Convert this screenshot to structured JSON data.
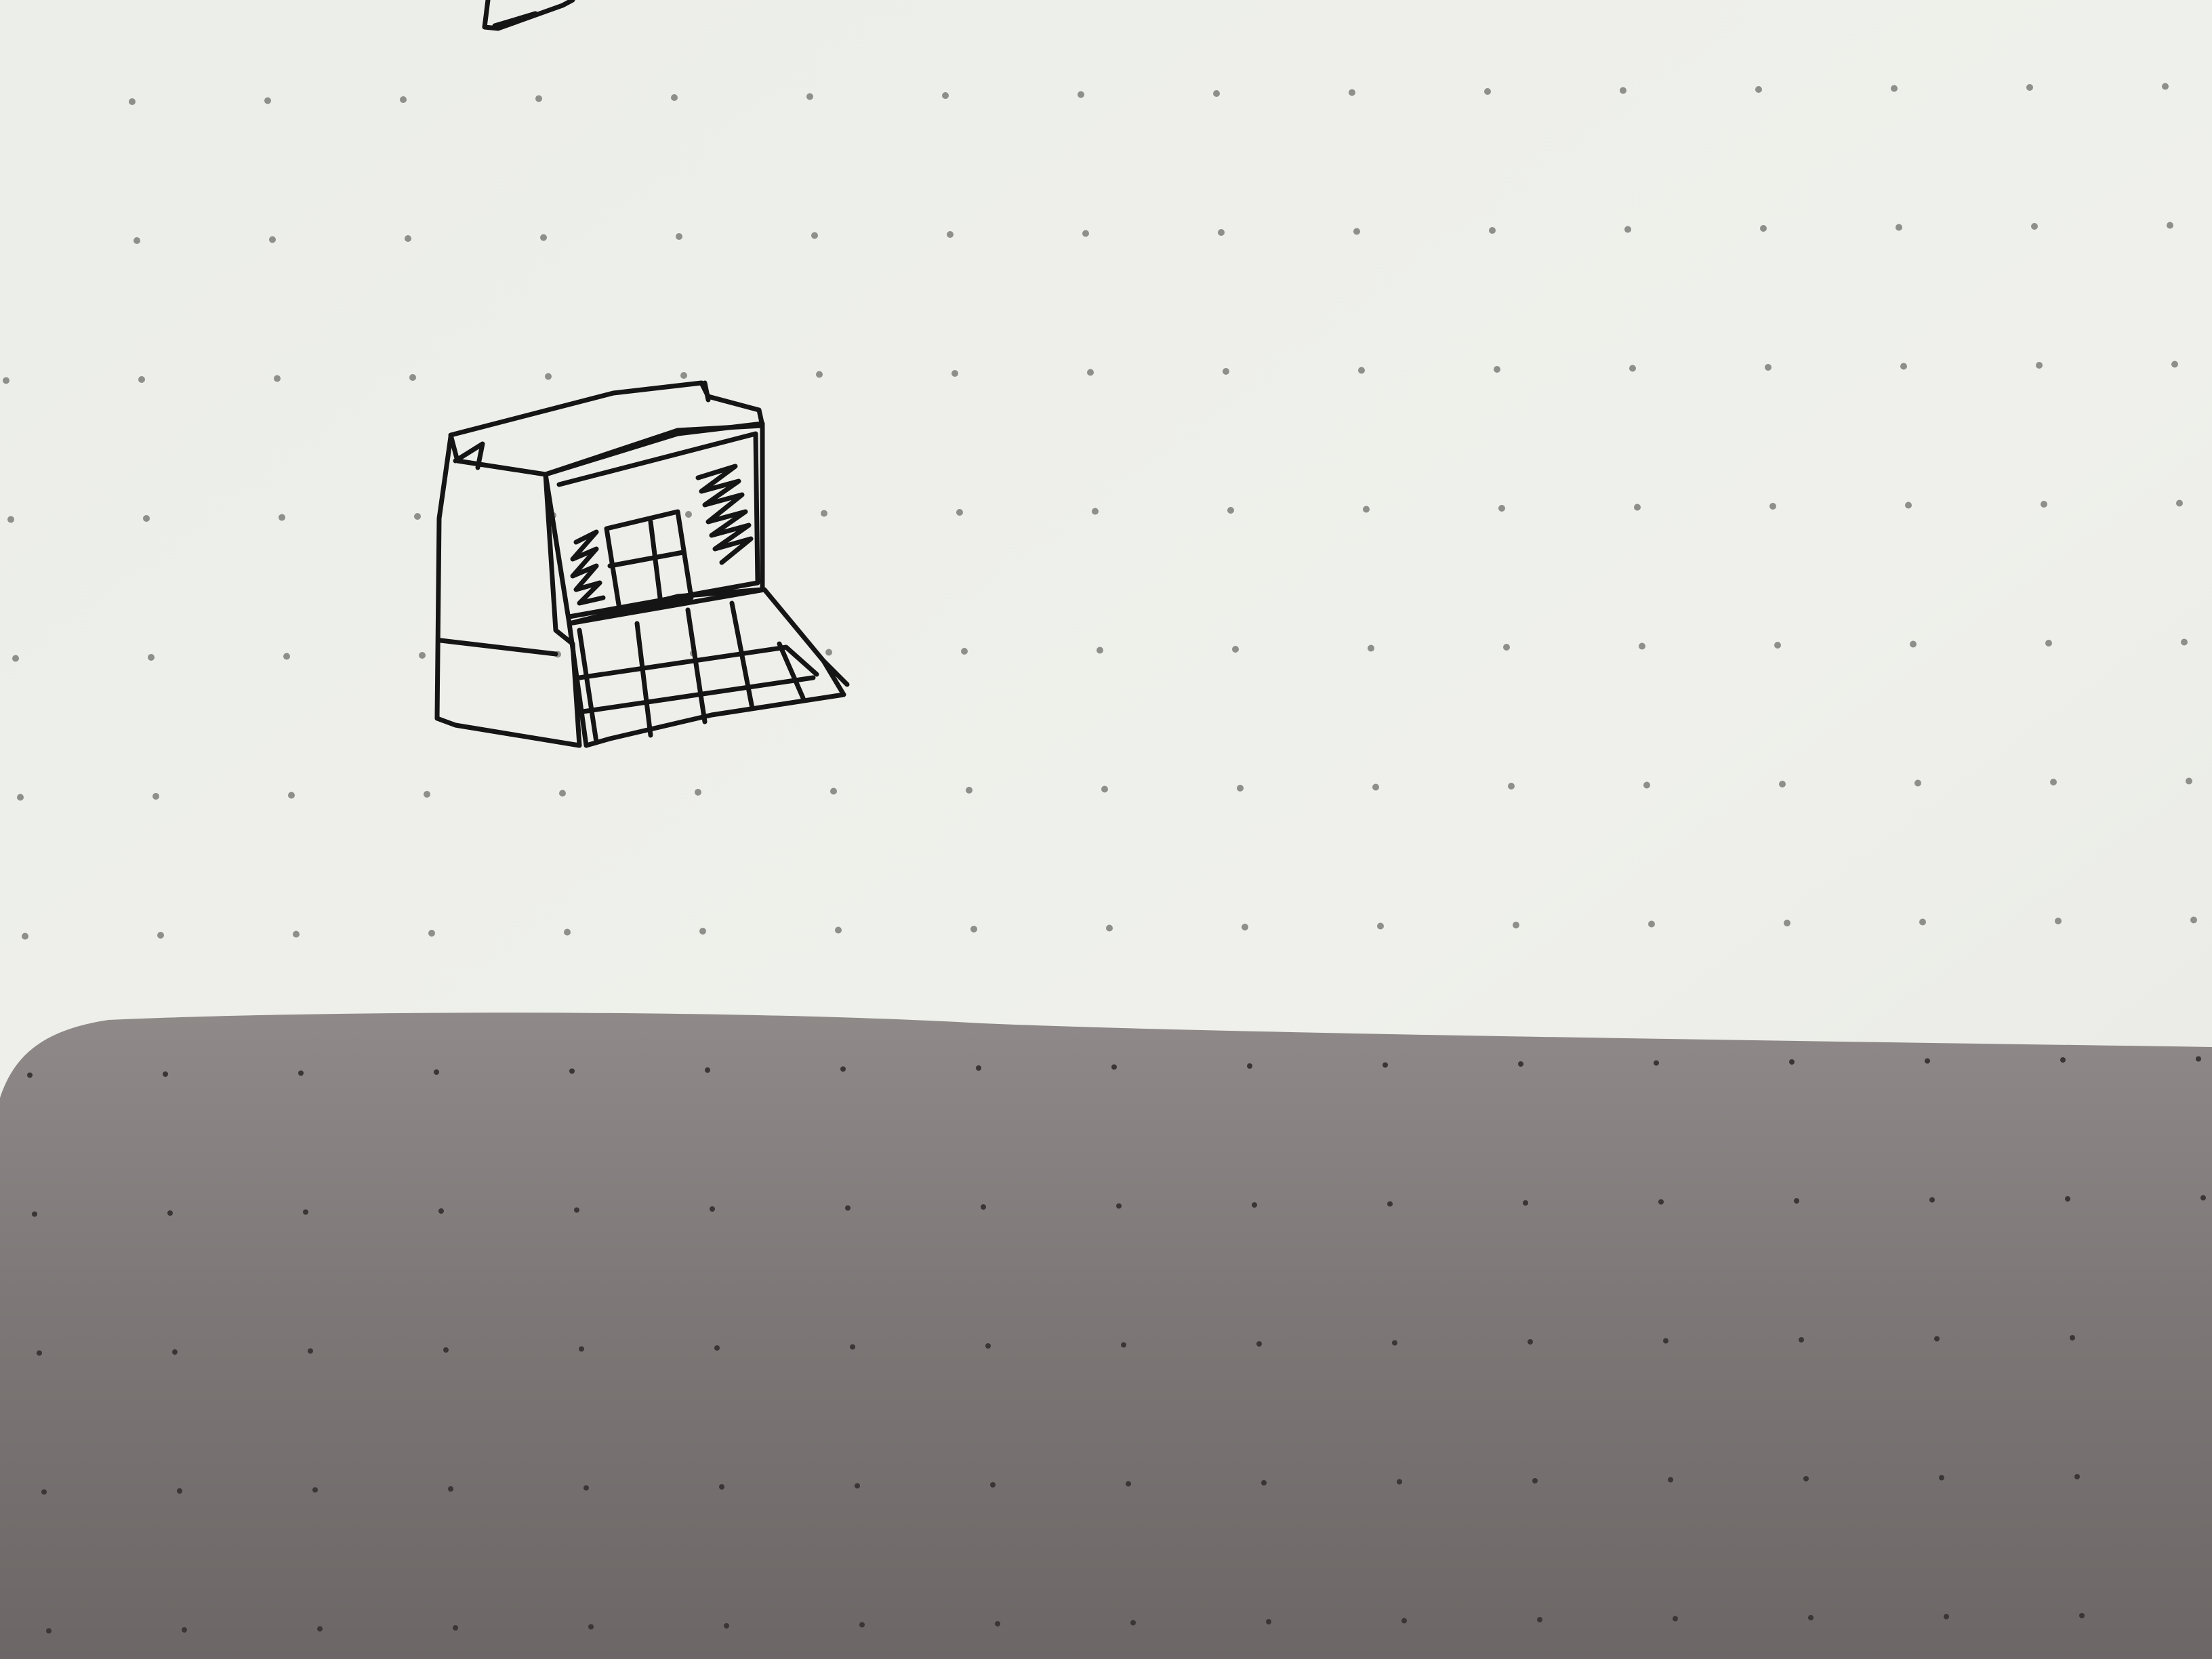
{
  "scene": {
    "kind": "photo of dot-grid notebook page with pen sketch",
    "sketch_subject": "computer-terminal-sketch",
    "colors": {
      "paper_light": "#eeefea",
      "paper_mid": "#e6e7e2",
      "shadow_top": "#8f8a89",
      "shadow_bottom": "#6f6a69",
      "ink": "#151515",
      "dot_light": "#8e8e8a",
      "dot_shadow": "#3a3636"
    }
  }
}
